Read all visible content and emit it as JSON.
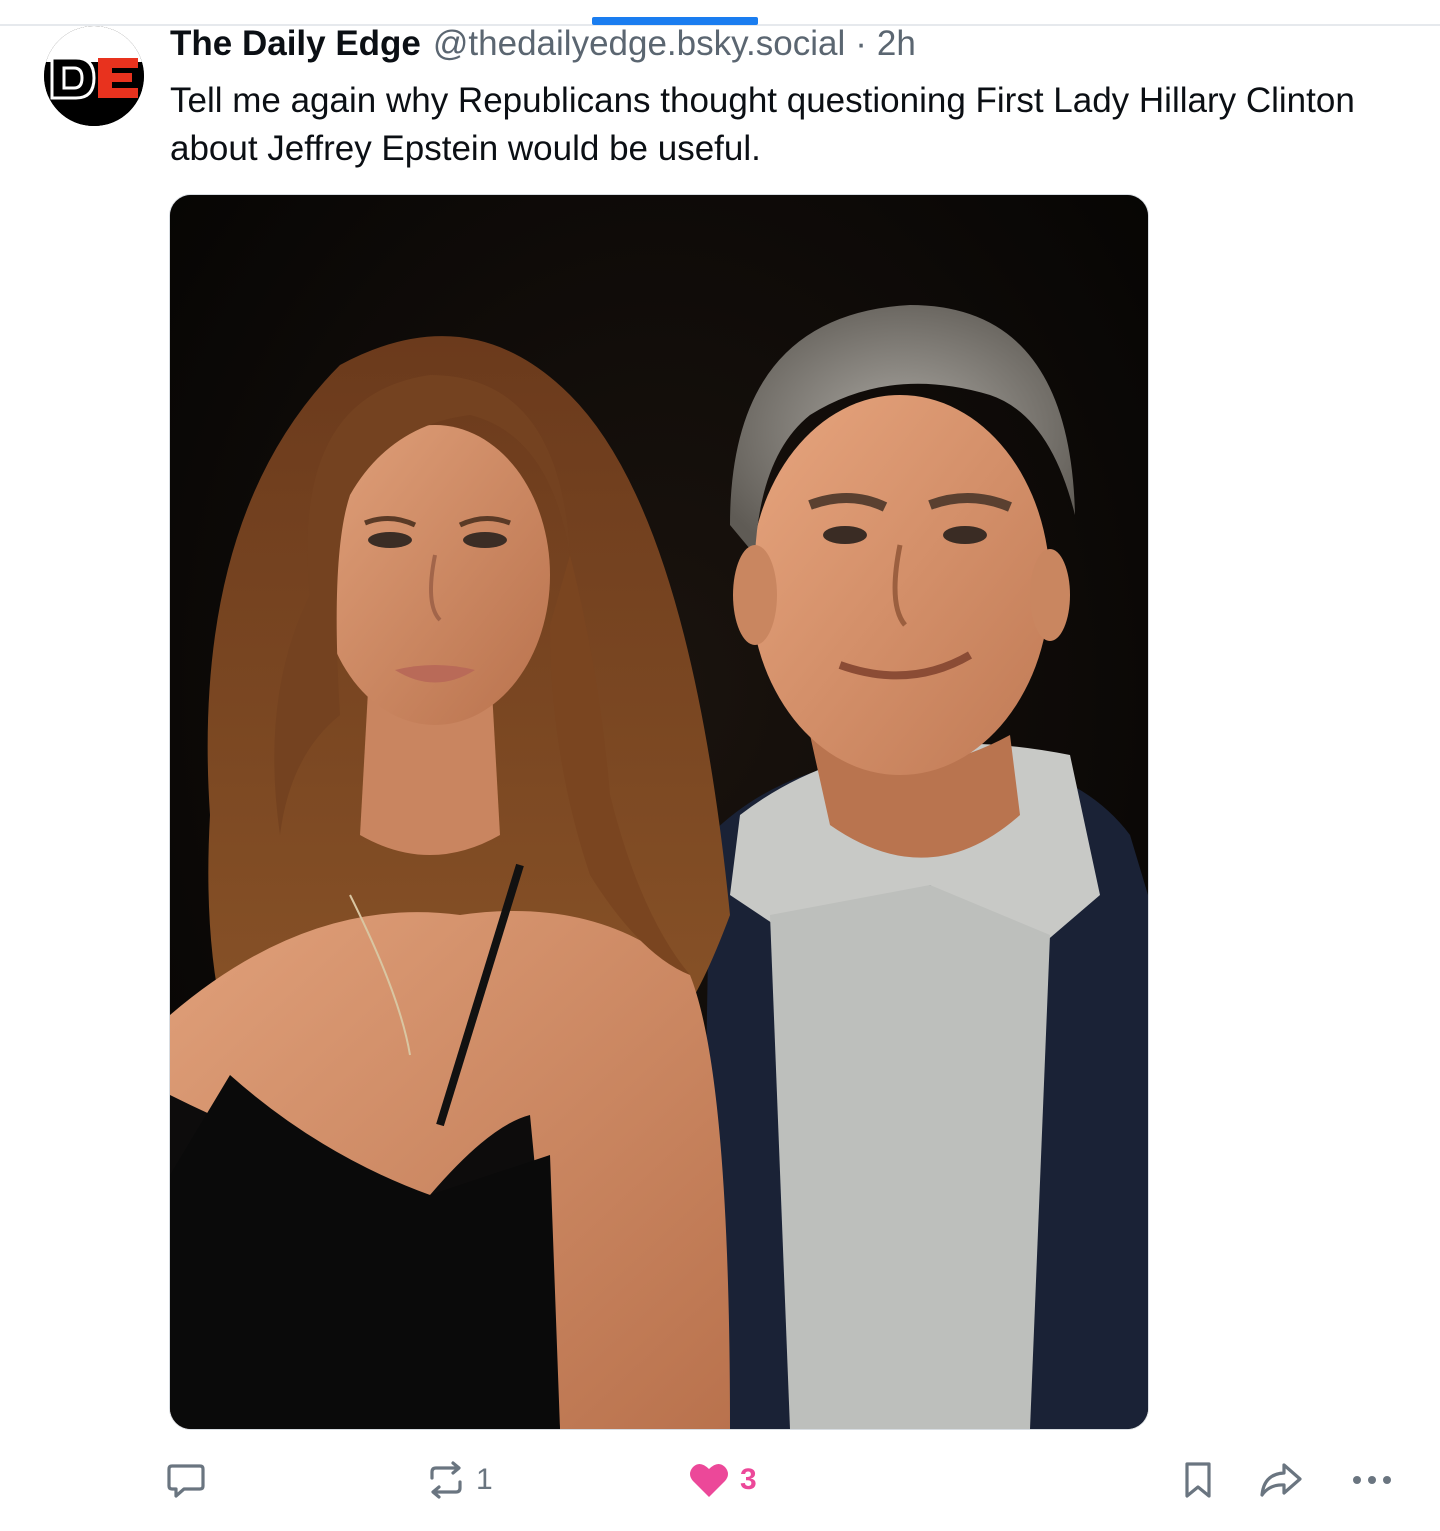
{
  "post": {
    "author_name": "The Daily Edge",
    "author_handle": "@thedailyedge.bsky.social",
    "separator": "·",
    "time": "2h",
    "avatar_text": "DE",
    "text": "Tell me again why Republicans thought questioning First Lady Hillary Clinton about Jeffrey Epstein would be useful."
  },
  "actions": {
    "reply_icon": "speech-bubble-icon",
    "repost_icon": "repost-arrows-icon",
    "repost_count": "1",
    "like_icon": "heart-icon",
    "like_count": "3",
    "liked": true,
    "bookmark_icon": "bookmark-icon",
    "share_icon": "share-arrow-icon",
    "more_icon": "ellipsis-icon"
  },
  "colors": {
    "accent": "#1a7df0",
    "like": "#ec4899",
    "muted": "#6a7580",
    "avatar_red": "#e8321e"
  }
}
